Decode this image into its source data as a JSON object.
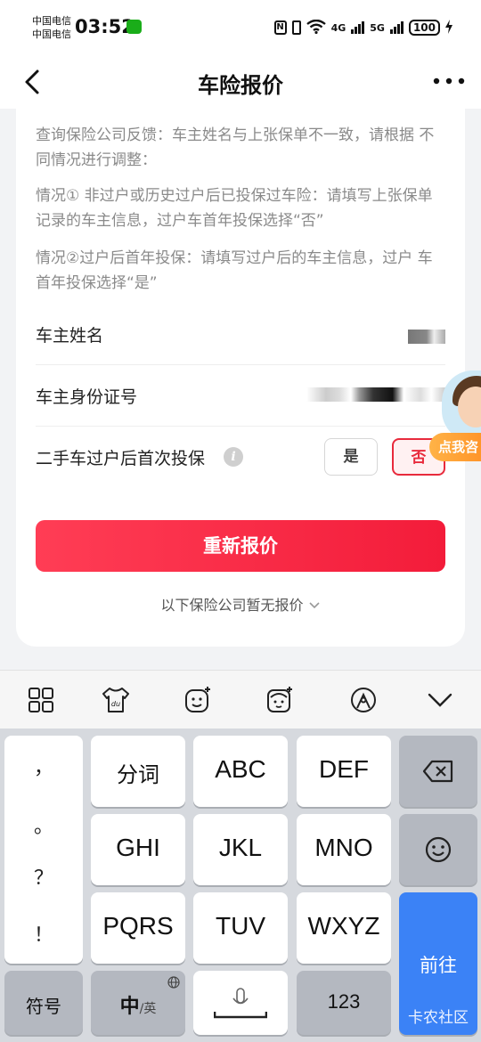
{
  "status_bar": {
    "carrier_1": "中国电信",
    "carrier_2": "中国电信",
    "time": "03:52",
    "net_1": "4G",
    "net_2": "5G",
    "battery": "100"
  },
  "header": {
    "title": "车险报价"
  },
  "notes": {
    "line_1": "查询保险公司反馈：车主姓名与上张保单不一致，请根据 不同情况进行调整：",
    "line_2": "情况① 非过户或历史过户后已投保过车险：请填写上张保单记录的车主信息，过户车首年投保选择“否”",
    "line_3": "情况②过户后首年投保：请填写过户后的车主信息，过户 车首年投保选择“是”"
  },
  "form": {
    "owner_name_label": "车主姓名",
    "owner_id_label": "车主身份证号",
    "first_insure_label": "二手车过户后首次投保",
    "yes_label": "是",
    "no_label": "否",
    "selected": "否"
  },
  "actions": {
    "requote_label": "重新报价",
    "no_quote_label": "以下保险公司暂无报价"
  },
  "floating": {
    "click_me": "点我咨"
  },
  "keyboard": {
    "toolbar_icons": [
      "grid-icon",
      "shirt-du-icon",
      "emoji-plus-icon",
      "sticker-icon",
      "handwrite-icon",
      "collapse-icon"
    ],
    "punctuation": [
      "，",
      "。",
      "？",
      "！"
    ],
    "row_1": [
      "分词",
      "ABC",
      "DEF"
    ],
    "row_2": [
      "GHI",
      "JKL",
      "MNO"
    ],
    "row_3": [
      "PQRS",
      "TUV",
      "WXYZ"
    ],
    "symbols_label": "符号",
    "chinese_label": "中",
    "english_label": "/英",
    "numbers_label": "123",
    "go_label": "前往",
    "brand_watermark": "卡农社区"
  },
  "colors": {
    "accent": "#f31c3a",
    "keyboard_go": "#3b82f6"
  }
}
